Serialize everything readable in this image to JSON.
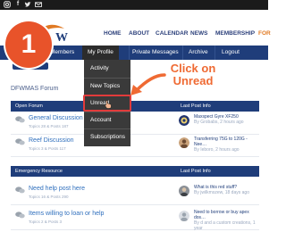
{
  "topbar": {
    "icons": [
      "instagram-icon",
      "facebook-icon",
      "twitter-icon",
      "email-icon"
    ]
  },
  "nav": {
    "items": [
      "HOME",
      "ABOUT",
      "CALENDAR",
      "NEWS",
      "MEMBERSHIP",
      "FOR"
    ],
    "active_index": 5
  },
  "subnav": {
    "members_label": "Members",
    "my_profile_label": "My Profile",
    "private_messages_label": "Private Messages",
    "archive_label": "Archive",
    "logout_label": "Logout"
  },
  "badge": {
    "number": "1"
  },
  "callout": {
    "line1": "Click on",
    "line2": "Unread"
  },
  "dropdown": {
    "items": [
      "Activity",
      "New Topics",
      "Unread",
      "Account",
      "Subscriptions"
    ],
    "highlighted_index": 2
  },
  "forum_title": "DFWMAS Forum",
  "sections": [
    {
      "name": "Open Forum",
      "last_post_header": "Last Post Info",
      "rows": [
        {
          "title": "General Discussion",
          "stats": "Topics 28 & Posts 187",
          "last_post_title": "Maxspect Gyre XF250",
          "last_post_meta": "By Grobabs, 2 hours ago"
        },
        {
          "title": "Reef Discussion",
          "stats": "Topics 3 & Posts 117",
          "last_post_title": "Transferring 75G to 120G - Nee…",
          "last_post_meta": "By Ieboro, 2 hours ago"
        }
      ]
    },
    {
      "name": "Emergency Resource",
      "last_post_header": "Last Post Info",
      "rows": [
        {
          "title": "Need help post here",
          "stats": "Topics 16 & Posts 290",
          "last_post_title": "What is this red stuff?",
          "last_post_meta": "By jwilkmszew, 18 days ago"
        },
        {
          "title": "Items willing to loan or help",
          "stats": "Topics 2 & Posts 3",
          "last_post_title": "Need to borrow or buy apex dos…",
          "last_post_meta": "By d and a custom creations, 1 year"
        }
      ]
    }
  ],
  "colors": {
    "navy": "#1f3d7a",
    "accent_orange": "#e8532a",
    "callout_orange": "#ef6a33",
    "highlight_red": "#e23b3b",
    "link_blue": "#2f6fbd"
  }
}
